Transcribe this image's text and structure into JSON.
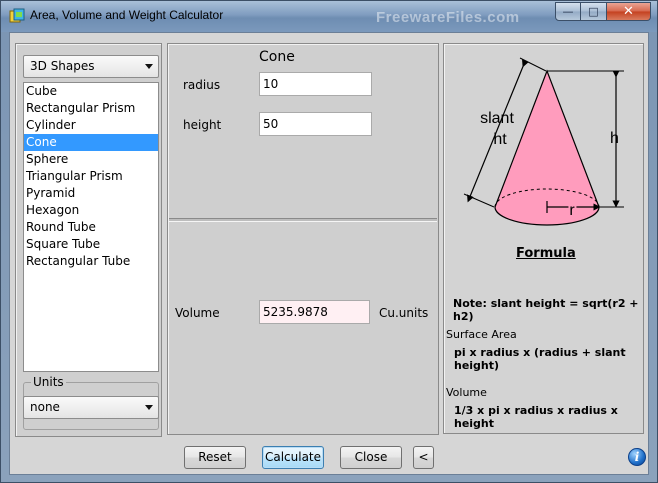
{
  "window": {
    "title": "Area, Volume and Weight Calculator",
    "watermark": "FreewareFiles.com",
    "minimize_glyph": "—",
    "maximize_glyph": "□",
    "close_glyph": "✕"
  },
  "left": {
    "shape_category": "3D Shapes",
    "shapes": [
      "Cube",
      "Rectangular Prism",
      "Cylinder",
      "Cone",
      "Sphere",
      "Triangular Prism",
      "Pyramid",
      "Hexagon",
      "Round Tube",
      "Square Tube",
      "Rectangular Tube"
    ],
    "selected_index": 3,
    "units_label": "Units",
    "units_value": "none"
  },
  "center": {
    "shape_title": "Cone",
    "radius_label": "radius",
    "radius_value": "10",
    "height_label": "height",
    "height_value": "50",
    "volume_label": "Volume",
    "volume_value": "5235.9878",
    "volume_units": "Cu.units"
  },
  "diagram": {
    "slant_label_1": "slant",
    "slant_label_2": "ht",
    "h_label": "h",
    "r_label": "r",
    "cone_color": "#ff9cbd"
  },
  "formula": {
    "title": "Formula",
    "note": "Note: slant height = sqrt(r2 + h2)",
    "surface_area_label": "Surface Area",
    "surface_area_formula": "pi x radius x (radius + slant height)",
    "volume_label": "Volume",
    "volume_formula": "1/3 x pi x radius x radius x height"
  },
  "buttons": {
    "reset": "Reset",
    "calculate": "Calculate",
    "close": "Close",
    "collapse": "<"
  },
  "info_glyph": "i"
}
